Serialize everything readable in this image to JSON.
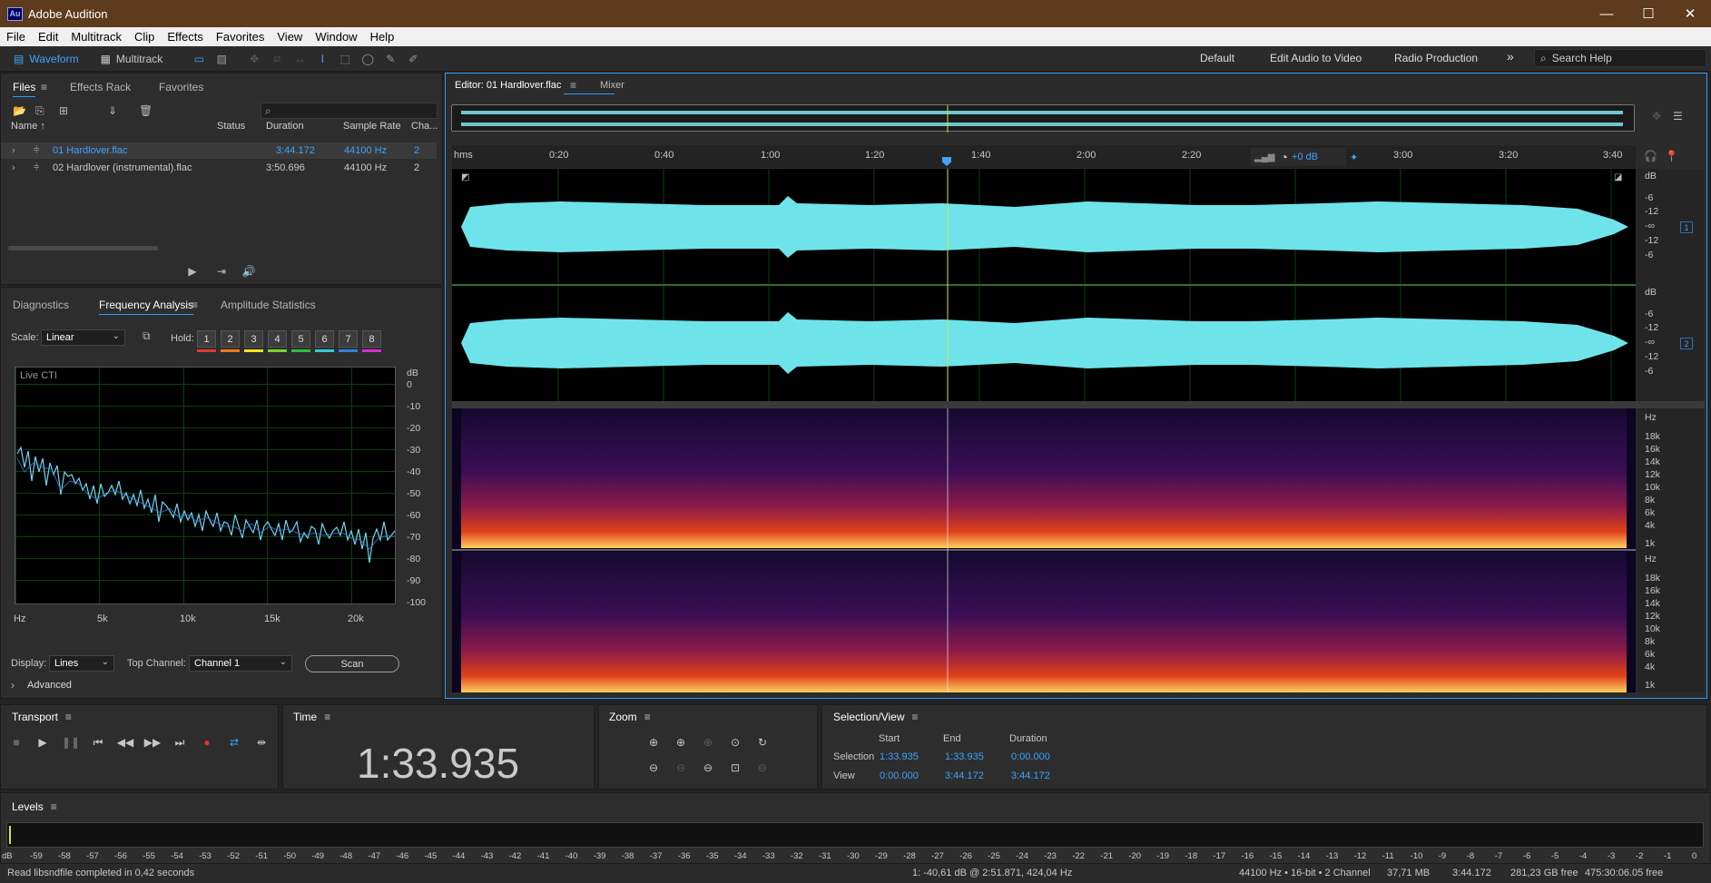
{
  "window": {
    "title": "Adobe Audition",
    "icon": "Au"
  },
  "window_controls": {
    "minimize": "—",
    "maximize": "☐",
    "close": "✕"
  },
  "menu": [
    "File",
    "Edit",
    "Multitrack",
    "Clip",
    "Effects",
    "Favorites",
    "View",
    "Window",
    "Help"
  ],
  "toolbar": {
    "waveform": "Waveform",
    "multitrack": "Multitrack"
  },
  "workspaces": [
    "Default",
    "Edit Audio to Video",
    "Radio Production"
  ],
  "workspaces_more": "»",
  "search": {
    "label": "Search Help"
  },
  "files_panel": {
    "tabs": [
      "Files",
      "Effects Rack",
      "Favorites"
    ],
    "columns": {
      "name": "Name ↑",
      "status": "Status",
      "duration": "Duration",
      "sample_rate": "Sample Rate",
      "channels": "Cha..."
    },
    "rows": [
      {
        "name": "01 Hardlover.flac",
        "status": "",
        "duration": "3:44.172",
        "sample_rate": "44100 Hz",
        "channels": "2",
        "selected": true
      },
      {
        "name": "02 Hardlover (instrumental).flac",
        "status": "",
        "duration": "3:50.696",
        "sample_rate": "44100 Hz",
        "channels": "2",
        "selected": false
      }
    ]
  },
  "analysis_panel": {
    "tabs": [
      "Diagnostics",
      "Frequency Analysis",
      "Amplitude Statistics"
    ],
    "scale_label": "Scale:",
    "scale_value": "Linear",
    "hold_label": "Hold:",
    "hold_buttons": [
      "1",
      "2",
      "3",
      "4",
      "5",
      "6",
      "7",
      "8"
    ],
    "hold_colors": [
      "#e23b2e",
      "#f07a1a",
      "#f2e21b",
      "#79d32a",
      "#2bbf3b",
      "#2fd0d6",
      "#2f7fe0",
      "#d22fd6"
    ],
    "plot_label": "Live CTI",
    "db_unit": "dB",
    "db_ticks": [
      "0",
      "-10",
      "-20",
      "-30",
      "-40",
      "-50",
      "-60",
      "-70",
      "-80",
      "-90",
      "-100"
    ],
    "hz_ticks": [
      "Hz",
      "5k",
      "10k",
      "15k",
      "20k"
    ],
    "display_label": "Display:",
    "display_value": "Lines",
    "top_channel_label": "Top Channel:",
    "top_channel_value": "Channel 1",
    "scan_button": "Scan",
    "advanced": "Advanced"
  },
  "editor": {
    "tab": "Editor: 01 Hardlover.flac",
    "mixer_tab": "Mixer",
    "ruler_unit": "hms",
    "ruler_labels": [
      "0:20",
      "0:40",
      "1:00",
      "1:20",
      "1:40",
      "2:00",
      "2:20",
      "3:00",
      "3:20",
      "3:40"
    ],
    "volume": "+0 dB",
    "waveform_db_labels": [
      "dB",
      "-6",
      "-12",
      "-∞",
      "-12",
      "-6"
    ],
    "channel_numbers": [
      "1",
      "2"
    ],
    "spectral_hz_labels": [
      "Hz",
      "18k",
      "16k",
      "14k",
      "12k",
      "10k",
      "8k",
      "6k",
      "4k",
      "1k"
    ]
  },
  "transport": {
    "title": "Transport"
  },
  "time": {
    "title": "Time",
    "value": "1:33.935"
  },
  "zoom": {
    "title": "Zoom"
  },
  "selection": {
    "title": "Selection/View",
    "headers": [
      "Start",
      "End",
      "Duration"
    ],
    "rows": [
      {
        "label": "Selection",
        "start": "1:33.935",
        "end": "1:33.935",
        "duration": "0:00.000"
      },
      {
        "label": "View",
        "start": "0:00.000",
        "end": "3:44.172",
        "duration": "3:44.172"
      }
    ]
  },
  "levels": {
    "title": "Levels",
    "scale": [
      "dB",
      "-59",
      "-58",
      "-57",
      "-56",
      "-55",
      "-54",
      "-53",
      "-52",
      "-51",
      "-50",
      "-49",
      "-48",
      "-47",
      "-46",
      "-45",
      "-44",
      "-43",
      "-42",
      "-41",
      "-40",
      "-39",
      "-38",
      "-37",
      "-36",
      "-35",
      "-34",
      "-33",
      "-32",
      "-31",
      "-30",
      "-29",
      "-28",
      "-27",
      "-26",
      "-25",
      "-24",
      "-23",
      "-22",
      "-21",
      "-20",
      "-19",
      "-18",
      "-17",
      "-16",
      "-15",
      "-14",
      "-13",
      "-12",
      "-11",
      "-10",
      "-9",
      "-8",
      "-7",
      "-6",
      "-5",
      "-4",
      "-3",
      "-2",
      "-1",
      "0"
    ]
  },
  "status": {
    "message": "Read libsndfile completed in 0,42 seconds",
    "cursor": "1: -40,61 dB @ 2:51.871, 424,04 Hz",
    "format": "44100 Hz • 16-bit • 2 Channel",
    "size": "37,71 MB",
    "duration": "3:44.172",
    "free": "281,23 GB free",
    "time_free": "475:30:06.05 free"
  }
}
